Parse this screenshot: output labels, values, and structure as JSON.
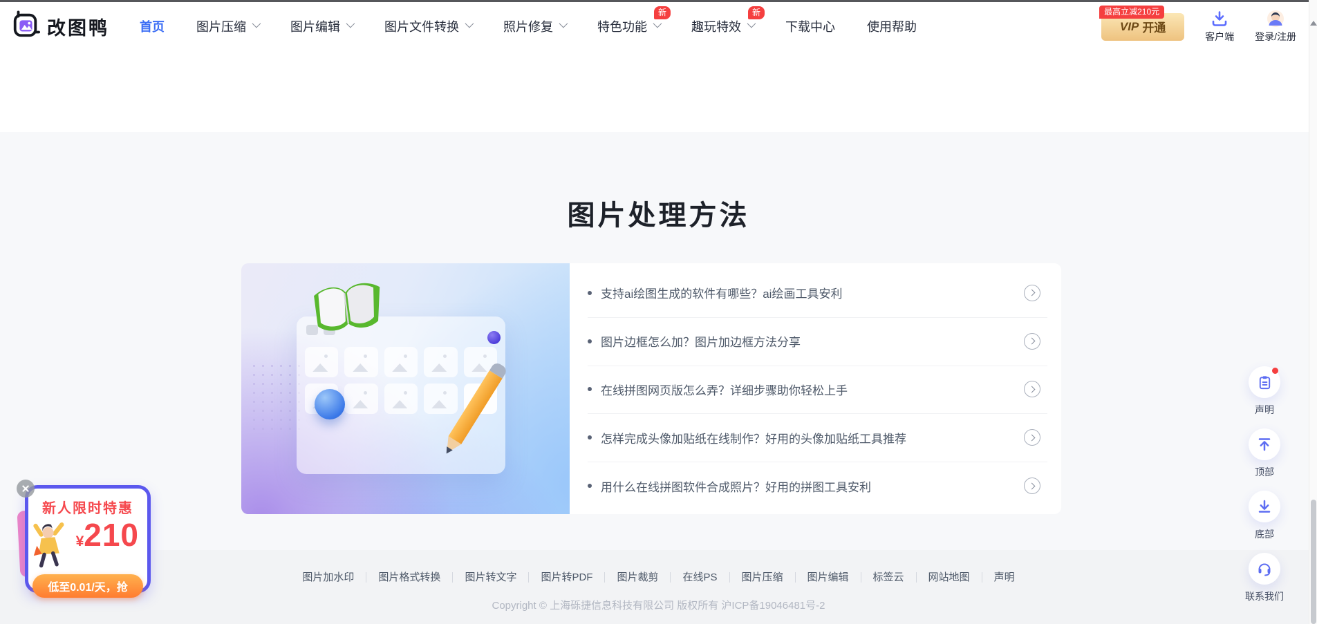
{
  "brand": {
    "name": "改图鸭"
  },
  "nav": {
    "items": [
      {
        "label": "首页",
        "active": true
      },
      {
        "label": "图片压缩",
        "dropdown": true
      },
      {
        "label": "图片编辑",
        "dropdown": true
      },
      {
        "label": "图片文件转换",
        "dropdown": true
      },
      {
        "label": "照片修复",
        "dropdown": true
      },
      {
        "label": "特色功能",
        "dropdown": true,
        "badge": "新"
      },
      {
        "label": "趣玩特效",
        "dropdown": true,
        "badge": "新"
      },
      {
        "label": "下载中心"
      },
      {
        "label": "使用帮助"
      }
    ],
    "vip": {
      "ribbon": "最高立减210元",
      "word": "VIP",
      "action": "开通"
    },
    "client_label": "客户端",
    "login_label": "登录/注册"
  },
  "main": {
    "section_title": "图片处理方法",
    "articles": [
      {
        "title": "支持ai绘图生成的软件有哪些？ai绘画工具安利"
      },
      {
        "title": "图片边框怎么加？图片加边框方法分享"
      },
      {
        "title": "在线拼图网页版怎么弄？详细步骤助你轻松上手"
      },
      {
        "title": "怎样完成头像加贴纸在线制作？好用的头像加贴纸工具推荐"
      },
      {
        "title": "用什么在线拼图软件合成照片？好用的拼图工具安利"
      }
    ]
  },
  "promo": {
    "title": "新人限时特惠",
    "currency": "¥",
    "amount": "210",
    "button": "低至0.01/天，抢"
  },
  "floating": {
    "items": [
      {
        "label": "声明",
        "icon": "clipboard-icon",
        "dot": true
      },
      {
        "label": "顶部",
        "icon": "arrow-to-top-icon"
      },
      {
        "label": "底部",
        "icon": "arrow-to-bottom-icon"
      },
      {
        "label": "联系我们",
        "icon": "headset-icon"
      }
    ]
  },
  "footer": {
    "links": [
      "图片加水印",
      "图片格式转换",
      "图片转文字",
      "图片转PDF",
      "图片裁剪",
      "在线PS",
      "图片压缩",
      "图片编辑",
      "标签云",
      "网站地图",
      "声明"
    ],
    "copyright": "Copyright © 上海砾捷信息科技有限公司 版权所有 沪ICP备19046481号-2"
  },
  "colors": {
    "accent_blue": "#3c6ef5",
    "badge_red": "#f53f3f",
    "vip_gold_light": "#fbe7b6",
    "vip_gold_dark": "#eec27f",
    "vip_text": "#6e4a16",
    "float_icon_blue": "#5c6cf2",
    "promo_red": "#f5484d",
    "promo_border_purple": "#5b58ee",
    "promo_orange": "#ff7c30",
    "text_dark": "#1d2129",
    "text_body": "#4e5969"
  }
}
